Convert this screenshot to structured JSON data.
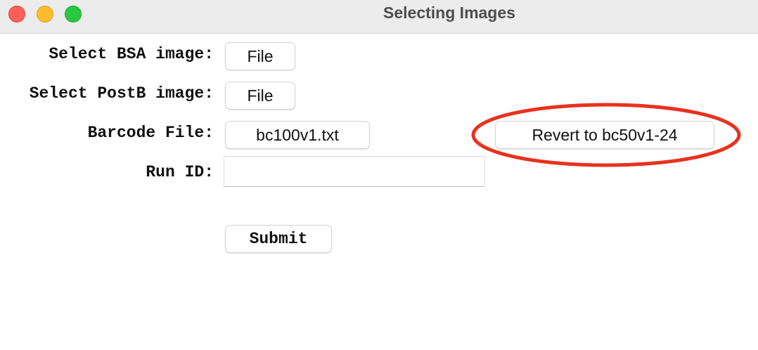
{
  "window": {
    "title": "Selecting Images"
  },
  "form": {
    "bsa_label": "Select BSA image:",
    "bsa_button": "File",
    "postb_label": "Select PostB image:",
    "postb_button": "File",
    "barcode_label": "Barcode File:",
    "barcode_button": "bc100v1.txt",
    "revert_button": "Revert to bc50v1-24",
    "runid_label": "Run ID:",
    "runid_value": "",
    "submit_button": "Submit"
  },
  "colors": {
    "annotation_ellipse": "#e8321f"
  }
}
